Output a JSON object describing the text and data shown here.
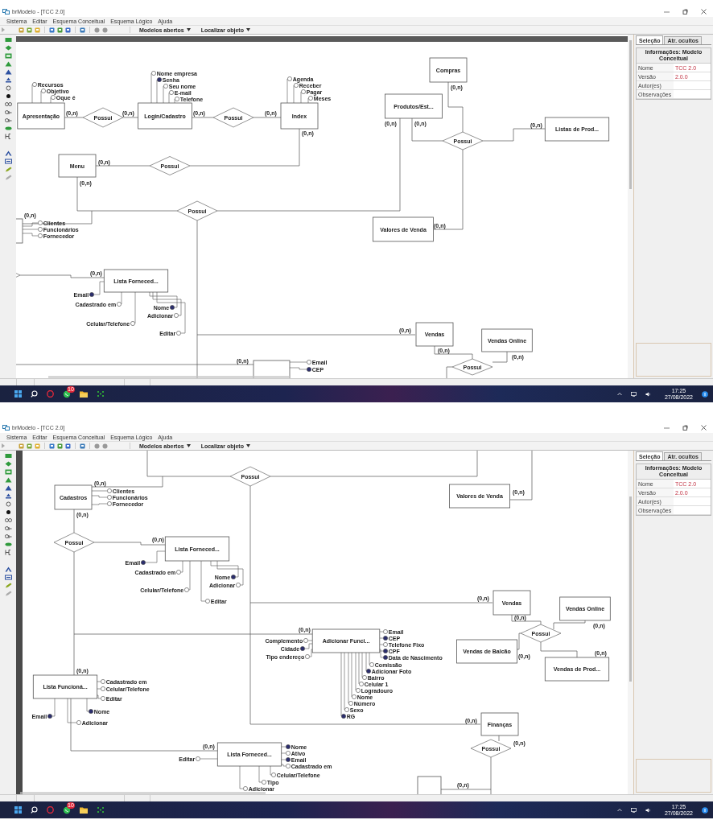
{
  "screens": [
    {
      "window": {
        "title": "brModelo - [TCC 2.0]"
      },
      "menu": [
        "Sistema",
        "Editar",
        "Esquema Conceitual",
        "Esquema Lógico",
        "Ajuda"
      ],
      "toolbar": {
        "dropdowns": [
          "Modelos abertos",
          "Localizar objeto"
        ]
      },
      "panel": {
        "tabs": [
          {
            "label": "Seleção",
            "selected": true
          },
          {
            "label": "Atr. ocultos",
            "selected": false
          }
        ],
        "header": "Informações: Modelo Conceitual",
        "rows": [
          {
            "label": "Nome",
            "value": "TCC 2.0"
          },
          {
            "label": "Versão",
            "value": "2.0.0"
          },
          {
            "label": "Autor(es)"
          },
          {
            "label": "Observações"
          }
        ]
      },
      "diagram": {
        "entities": [
          {
            "label": "Apresentação"
          },
          {
            "label": "Login/Cadastro"
          },
          {
            "label": "Index"
          },
          {
            "label": "Menu"
          },
          {
            "label": "Compras"
          },
          {
            "label": "Produtos/Est..."
          },
          {
            "label": "Listas de Prod..."
          },
          {
            "label": "Valores de Venda"
          },
          {
            "label": "Lista Forneced..."
          },
          {
            "label": "Vendas"
          },
          {
            "label": "Vendas Online"
          }
        ],
        "relationships": [
          {
            "label": "Possui"
          },
          {
            "label": "Possui"
          },
          {
            "label": "Possui"
          },
          {
            "label": "Possui"
          },
          {
            "label": "Possui"
          },
          {
            "label": "Possui"
          }
        ],
        "attributes": [
          {
            "label": "Recursos",
            "identifier": false
          },
          {
            "label": "Objetivo",
            "identifier": false
          },
          {
            "label": "Oque é",
            "identifier": false
          },
          {
            "label": "Nome empresa",
            "identifier": false
          },
          {
            "label": "Senha",
            "identifier": true
          },
          {
            "label": "Seu nome",
            "identifier": false
          },
          {
            "label": "E-mail",
            "identifier": false
          },
          {
            "label": "Telefone",
            "identifier": false
          },
          {
            "label": "Agenda",
            "identifier": false
          },
          {
            "label": "Receber",
            "identifier": false
          },
          {
            "label": "Pagar",
            "identifier": false
          },
          {
            "label": "Meses",
            "identifier": false
          },
          {
            "label": "Clientes",
            "identifier": false
          },
          {
            "label": "Funcionários",
            "identifier": false
          },
          {
            "label": "Fornecedor",
            "identifier": false
          },
          {
            "label": "Email",
            "identifier": true
          },
          {
            "label": "Cadastrado em",
            "identifier": false
          },
          {
            "label": "Nome",
            "identifier": true
          },
          {
            "label": "Adicionar",
            "identifier": false
          },
          {
            "label": "Celular/Telefone",
            "identifier": false
          },
          {
            "label": "Editar",
            "identifier": false
          },
          {
            "label": "Email",
            "identifier": false
          },
          {
            "label": "CEP",
            "identifier": true
          }
        ],
        "cardinalities": [
          "(0,n)",
          "(0,n)",
          "(0,n)",
          "(0,n)",
          "(0,n)",
          "(0,n)",
          "(0,n)",
          "(0,n)",
          "(0,n)",
          "(0,n)",
          "(0,n)",
          "(0,n)",
          "(0,n)",
          "(0,n)",
          "(0,n)",
          "(0,n)",
          "(0,n)",
          "(0,n)"
        ]
      },
      "taskbar": {
        "badge": "10",
        "time": "17:25",
        "date": "27/08/2022"
      }
    },
    {
      "window": {
        "title": "brModelo - [TCC 2.0]"
      },
      "menu": [
        "Sistema",
        "Editar",
        "Esquema Conceitual",
        "Esquema Lógico",
        "Ajuda"
      ],
      "toolbar": {
        "dropdowns": [
          "Modelos abertos",
          "Localizar objeto"
        ]
      },
      "panel": {
        "tabs": [
          {
            "label": "Seleção",
            "selected": true
          },
          {
            "label": "Atr. ocultos",
            "selected": false
          }
        ],
        "header": "Informações: Modelo Conceitual",
        "rows": [
          {
            "label": "Nome",
            "value": "TCC 2.0"
          },
          {
            "label": "Versão",
            "value": "2.0.0"
          },
          {
            "label": "Autor(es)"
          },
          {
            "label": "Observações"
          }
        ]
      },
      "diagram": {
        "entities": [
          {
            "label": "Cadastros"
          },
          {
            "label": "Valores de Venda"
          },
          {
            "label": "Lista Forneced..."
          },
          {
            "label": "Vendas"
          },
          {
            "label": "Vendas Online"
          },
          {
            "label": "Adicionar Funci..."
          },
          {
            "label": "Vendas de Balcão"
          },
          {
            "label": "Vendas de Prod..."
          },
          {
            "label": "Lista Funcioná..."
          },
          {
            "label": "Finanças"
          },
          {
            "label": "Lista Forneced..."
          }
        ],
        "relationships": [
          {
            "label": "Possui"
          },
          {
            "label": "Possui"
          },
          {
            "label": "Possui"
          },
          {
            "label": "Possui"
          }
        ],
        "attributes": [
          {
            "label": "Clientes",
            "identifier": false
          },
          {
            "label": "Funcionários",
            "identifier": false
          },
          {
            "label": "Fornecedor",
            "identifier": false
          },
          {
            "label": "Email",
            "identifier": true
          },
          {
            "label": "Cadastrado em",
            "identifier": false
          },
          {
            "label": "Nome",
            "identifier": true
          },
          {
            "label": "Adicionar",
            "identifier": false
          },
          {
            "label": "Celular/Telefone",
            "identifier": false
          },
          {
            "label": "Editar",
            "identifier": false
          },
          {
            "label": "Email",
            "identifier": false
          },
          {
            "label": "CEP",
            "identifier": true
          },
          {
            "label": "Telefone Fixo",
            "identifier": false
          },
          {
            "label": "CPF",
            "identifier": true
          },
          {
            "label": "Data de Nascimento",
            "identifier": true
          },
          {
            "label": "Complemento",
            "identifier": false
          },
          {
            "label": "Cidade",
            "identifier": true
          },
          {
            "label": "Tipo endereço",
            "identifier": false
          },
          {
            "label": "Comissão",
            "identifier": false
          },
          {
            "label": "Adicionar Foto",
            "identifier": true
          },
          {
            "label": "Bairro",
            "identifier": false
          },
          {
            "label": "Celular 1",
            "identifier": false
          },
          {
            "label": "Logradouro",
            "identifier": false
          },
          {
            "label": "Nome",
            "identifier": false
          },
          {
            "label": "Número",
            "identifier": false
          },
          {
            "label": "Sexo",
            "identifier": false
          },
          {
            "label": "RG",
            "identifier": true
          },
          {
            "label": "Cadastrado em",
            "identifier": false
          },
          {
            "label": "Celular/Telefone",
            "identifier": false
          },
          {
            "label": "Editar",
            "identifier": false
          },
          {
            "label": "Nome",
            "identifier": true
          },
          {
            "label": "Email",
            "identifier": true
          },
          {
            "label": "Adicionar",
            "identifier": false
          },
          {
            "label": "Nome",
            "identifier": true
          },
          {
            "label": "Ativo",
            "identifier": false
          },
          {
            "label": "Email",
            "identifier": true
          },
          {
            "label": "Cadastrado em",
            "identifier": false
          },
          {
            "label": "Celular/Telefone",
            "identifier": false
          },
          {
            "label": "Tipo",
            "identifier": false
          },
          {
            "label": "Adicionar",
            "identifier": false
          },
          {
            "label": "Editar",
            "identifier": false
          }
        ],
        "cardinalities": [
          "(0,n)",
          "(0,n)",
          "(0,n)",
          "(0,n)",
          "(0,n)",
          "(0,n)",
          "(0,n)",
          "(0,n)",
          "(0,n)",
          "(0,n)",
          "(0,n)",
          "(0,n)",
          "(0,n)",
          "(0,n)",
          "(0,n)"
        ]
      },
      "taskbar": {
        "badge": "10",
        "time": "17:25",
        "date": "27/08/2022"
      }
    }
  ]
}
